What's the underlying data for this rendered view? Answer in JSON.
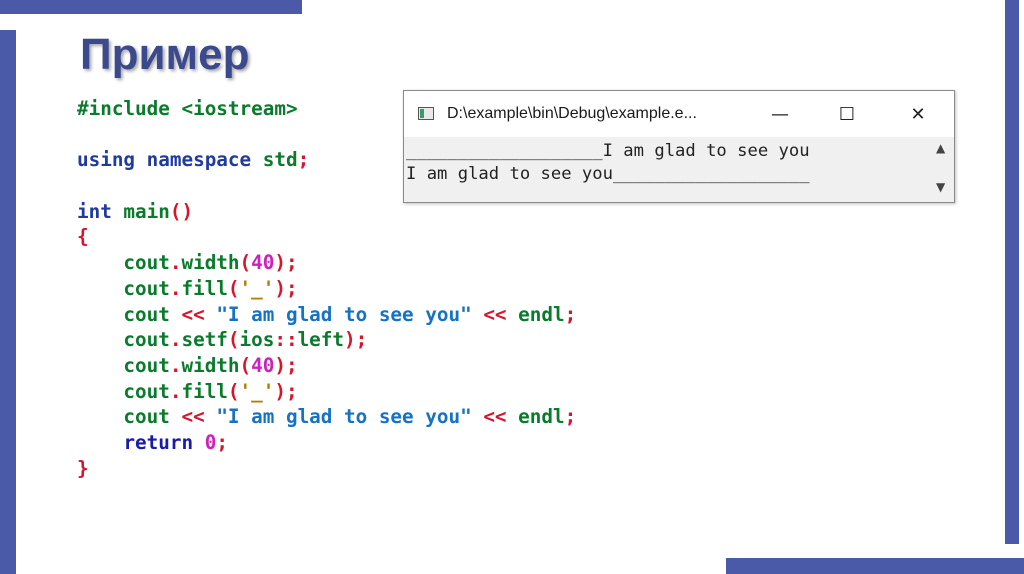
{
  "slide": {
    "title": "Пример",
    "accent_color": "#4a5aa8"
  },
  "code": {
    "lines": [
      [
        {
          "t": "#include <iostream>",
          "c": "g"
        }
      ],
      [
        {
          "t": "",
          "c": "g"
        }
      ],
      [
        {
          "t": "using",
          "c": "b"
        },
        {
          "t": " ",
          "c": "g"
        },
        {
          "t": "namespace",
          "c": "b"
        },
        {
          "t": " std",
          "c": "g"
        },
        {
          "t": ";",
          "c": "r"
        }
      ],
      [
        {
          "t": "",
          "c": "g"
        }
      ],
      [
        {
          "t": "int",
          "c": "b"
        },
        {
          "t": " main",
          "c": "g"
        },
        {
          "t": "()",
          "c": "r"
        }
      ],
      [
        {
          "t": "{",
          "c": "r"
        }
      ],
      [
        {
          "t": "    cout",
          "c": "g"
        },
        {
          "t": ".",
          "c": "r"
        },
        {
          "t": "width",
          "c": "g"
        },
        {
          "t": "(",
          "c": "r"
        },
        {
          "t": "40",
          "c": "m"
        },
        {
          "t": ");",
          "c": "r"
        }
      ],
      [
        {
          "t": "    cout",
          "c": "g"
        },
        {
          "t": ".",
          "c": "r"
        },
        {
          "t": "fill",
          "c": "g"
        },
        {
          "t": "(",
          "c": "r"
        },
        {
          "t": "'_'",
          "c": "o"
        },
        {
          "t": ");",
          "c": "r"
        }
      ],
      [
        {
          "t": "    cout ",
          "c": "g"
        },
        {
          "t": "<<",
          "c": "r"
        },
        {
          "t": " ",
          "c": "g"
        },
        {
          "t": "\"I am glad to see you\"",
          "c": "s"
        },
        {
          "t": " ",
          "c": "g"
        },
        {
          "t": "<<",
          "c": "r"
        },
        {
          "t": " endl",
          "c": "g"
        },
        {
          "t": ";",
          "c": "r"
        }
      ],
      [
        {
          "t": "    cout",
          "c": "g"
        },
        {
          "t": ".",
          "c": "r"
        },
        {
          "t": "setf",
          "c": "g"
        },
        {
          "t": "(",
          "c": "r"
        },
        {
          "t": "ios",
          "c": "g"
        },
        {
          "t": "::",
          "c": "r"
        },
        {
          "t": "left",
          "c": "g"
        },
        {
          "t": ");",
          "c": "r"
        }
      ],
      [
        {
          "t": "    cout",
          "c": "g"
        },
        {
          "t": ".",
          "c": "r"
        },
        {
          "t": "width",
          "c": "g"
        },
        {
          "t": "(",
          "c": "r"
        },
        {
          "t": "40",
          "c": "m"
        },
        {
          "t": ");",
          "c": "r"
        }
      ],
      [
        {
          "t": "    cout",
          "c": "g"
        },
        {
          "t": ".",
          "c": "r"
        },
        {
          "t": "fill",
          "c": "g"
        },
        {
          "t": "(",
          "c": "r"
        },
        {
          "t": "'_'",
          "c": "o"
        },
        {
          "t": ");",
          "c": "r"
        }
      ],
      [
        {
          "t": "    cout ",
          "c": "g"
        },
        {
          "t": "<<",
          "c": "r"
        },
        {
          "t": " ",
          "c": "g"
        },
        {
          "t": "\"I am glad to see you\"",
          "c": "s"
        },
        {
          "t": " ",
          "c": "g"
        },
        {
          "t": "<<",
          "c": "r"
        },
        {
          "t": " endl",
          "c": "g"
        },
        {
          "t": ";",
          "c": "r"
        }
      ],
      [
        {
          "t": "    ",
          "c": "g"
        },
        {
          "t": "return",
          "c": "k"
        },
        {
          "t": " ",
          "c": "g"
        },
        {
          "t": "0",
          "c": "m"
        },
        {
          "t": ";",
          "c": "r"
        }
      ],
      [
        {
          "t": "}",
          "c": "r"
        }
      ]
    ]
  },
  "console_window": {
    "title": "D:\\example\\bin\\Debug\\example.e...",
    "icons": {
      "app": "console-app-icon",
      "minimize": "minimize-icon",
      "maximize": "maximize-icon",
      "close": "close-icon"
    },
    "minimize_glyph": "—",
    "maximize_glyph": "☐",
    "close_glyph": "✕",
    "output_lines": [
      "___________________I am glad to see you",
      "I am glad to see you___________________"
    ],
    "scroll_up_glyph": "▲",
    "scroll_down_glyph": "▼"
  }
}
